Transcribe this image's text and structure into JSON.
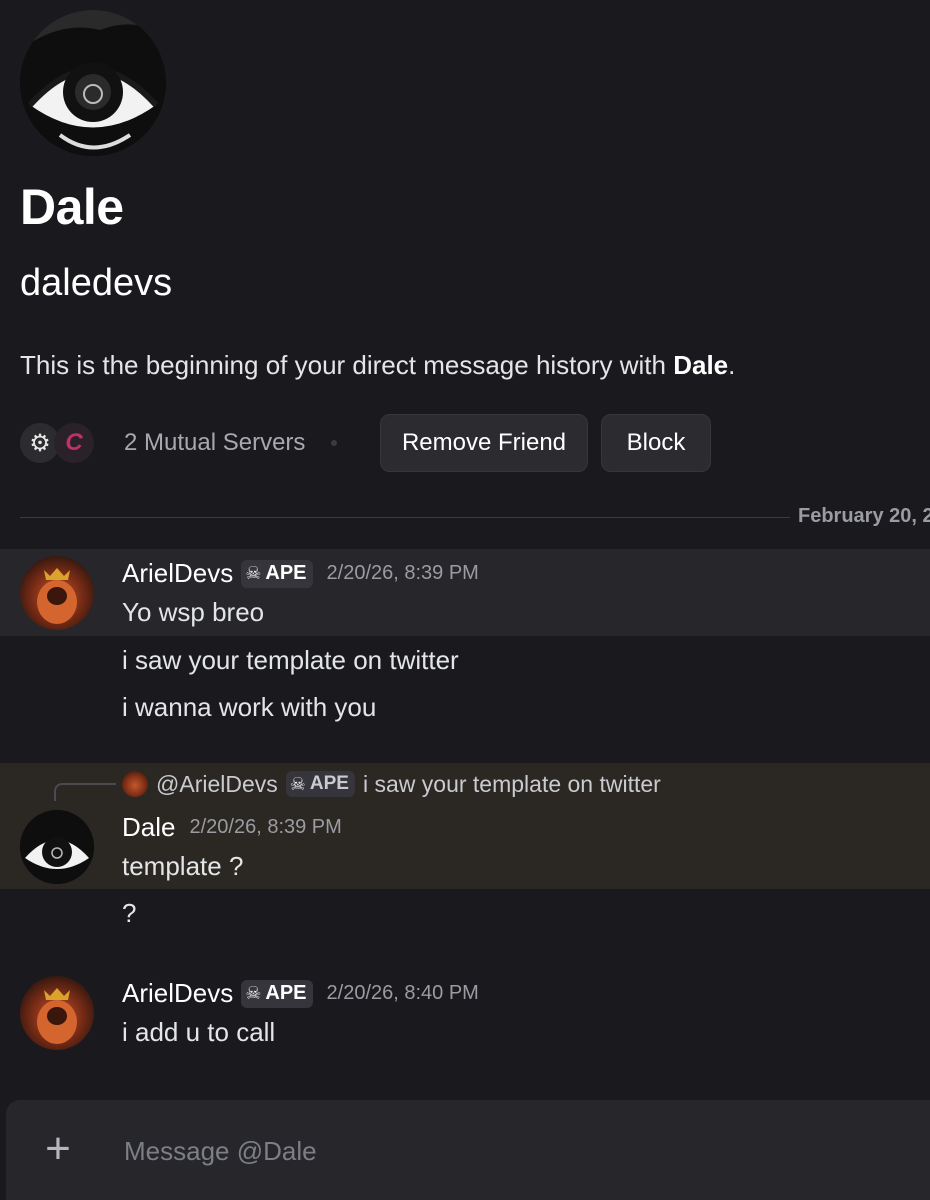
{
  "profile": {
    "display_name": "Dale",
    "username": "daledevs",
    "intro_prefix": "This is the beginning of your direct message history with ",
    "intro_name": "Dale",
    "intro_suffix": "."
  },
  "mutual": {
    "label": "2 Mutual Servers",
    "server_icons": [
      "gear-logo-icon",
      "c-logo-icon"
    ]
  },
  "actions": {
    "remove_friend": "Remove Friend",
    "block": "Block"
  },
  "date_divider": "February 20, 2",
  "messages": [
    {
      "author": "ArielDevs",
      "tag": "APE",
      "timestamp": "2/20/26, 8:39 PM",
      "lines": [
        "Yo wsp breo",
        "i saw your template on twitter",
        "i wanna work with you"
      ]
    },
    {
      "reply": {
        "author": "@ArielDevs",
        "tag": "APE",
        "text": "i saw your template on twitter"
      },
      "author": "Dale",
      "timestamp": "2/20/26, 8:39 PM",
      "lines": [
        "template ?",
        "?"
      ]
    },
    {
      "author": "ArielDevs",
      "tag": "APE",
      "timestamp": "2/20/26, 8:40 PM",
      "lines": [
        "i add u to call"
      ]
    }
  ],
  "composer": {
    "placeholder": "Message @Dale"
  },
  "colors": {
    "background": "#1a1a1e",
    "highlight": "#26262b",
    "reply_highlight": "#2b2723",
    "button": "#2b2b30"
  }
}
